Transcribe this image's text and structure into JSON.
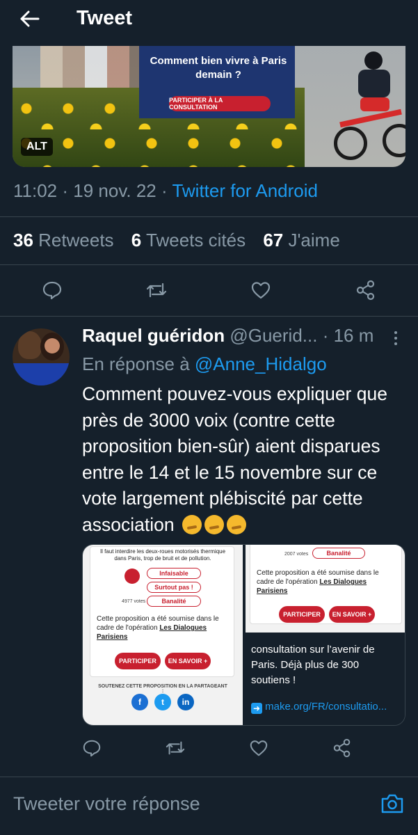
{
  "header": {
    "title": "Tweet"
  },
  "hero_image": {
    "card_title": "Comment bien vivre à Paris demain ?",
    "cta": "PARTICIPER À LA CONSULTATION",
    "alt_badge": "ALT"
  },
  "tweet_meta": {
    "time": "11:02",
    "date": "19 nov. 22",
    "source": "Twitter for Android"
  },
  "stats": {
    "retweets_count": "36",
    "retweets_label": "Retweets",
    "quotes_count": "6",
    "quotes_label": "Tweets cités",
    "likes_count": "67",
    "likes_label": "J'aime"
  },
  "actions": [
    "reply-icon",
    "retweet-icon",
    "like-icon",
    "share-icon"
  ],
  "reply": {
    "author_name": "Raquel guéridon",
    "author_handle": "@Guerid...",
    "time_ago": "· 16 m",
    "reply_prefix": "En réponse à",
    "reply_mention": "@Anne_Hidalgo",
    "text": "Comment pouvez-vous expliquer que près de 3000 voix (contre cette proposition bien-sûr) aient disparues entre le 14 et le 15 novembre sur ce vote largement plébiscité par cette association",
    "emojis": [
      "thinking-face",
      "thinking-face",
      "thinking-face"
    ],
    "media_left": {
      "proposal": "Il faut interdire les deux-roues motorisés thermique dans Paris, trop de bruit et de pollution.",
      "opt1": "Infaisable",
      "opt2": "Surtout pas !",
      "opt3": "Banalité",
      "votes": "4977 votes",
      "note": "Cette proposition a été soumise dans le cadre de l'opération",
      "note_link": "Les Dialogues Parisiens",
      "btn_participer": "PARTICIPER",
      "btn_savoir": "EN SAVOIR +",
      "share_caption": "SOUTENEZ CETTE PROPOSITION EN LA PARTAGEANT :"
    },
    "media_right": {
      "votes": "2007 votes",
      "opt": "Banalité",
      "note": "Cette proposition a été soumise dans le cadre de l'opération",
      "note_link": "Les Dialogues Parisiens",
      "btn_participer": "PARTICIPER",
      "btn_savoir": "EN SAVOIR +",
      "text": "consultation sur l’avenir de Paris. Déjà plus de 300 soutiens !",
      "link": "make.org/FR/consultatio..."
    }
  },
  "compose": {
    "placeholder": "Tweeter votre réponse"
  },
  "colors": {
    "background": "#15202b",
    "accent": "#1d9bf0",
    "muted": "#8899a6",
    "divider": "#38444d"
  }
}
